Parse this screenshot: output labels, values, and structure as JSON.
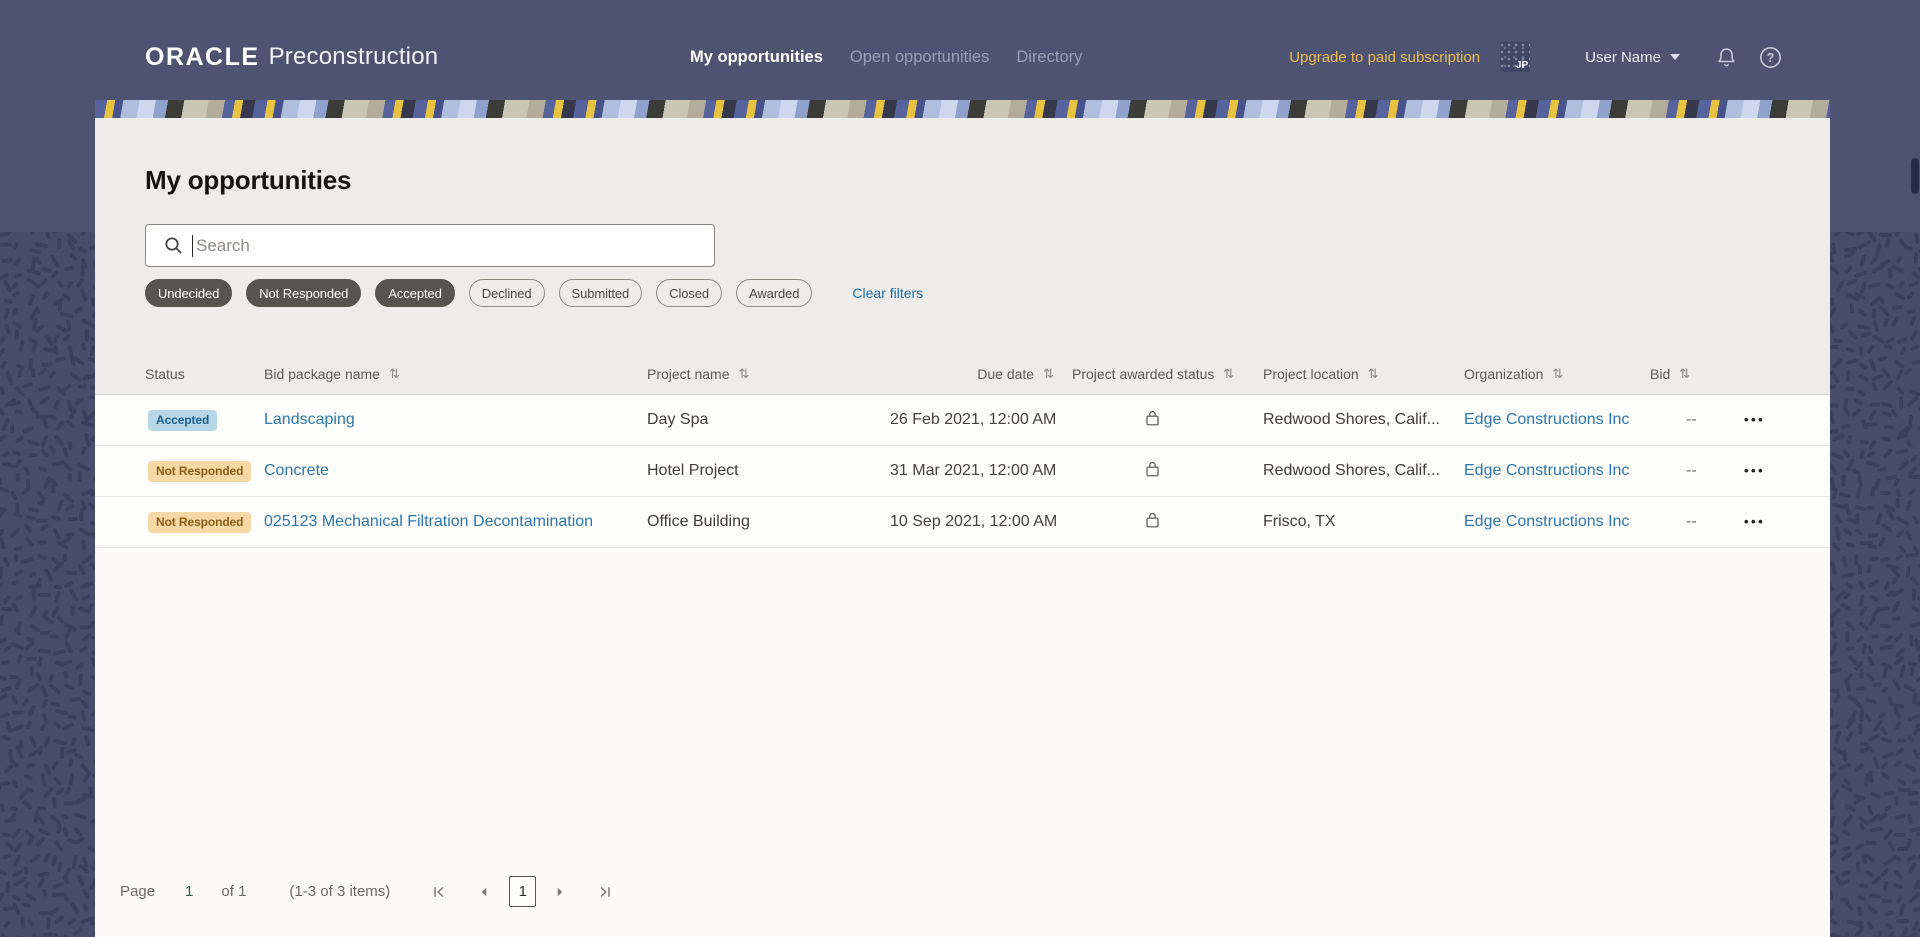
{
  "header": {
    "brand_oracle": "ORACLE",
    "brand_product": "Preconstruction",
    "nav": [
      {
        "label": "My opportunities",
        "active": true
      },
      {
        "label": "Open opportunities",
        "active": false
      },
      {
        "label": "Directory",
        "active": false
      }
    ],
    "upgrade_label": "Upgrade to paid subscription",
    "avatar_initials": "JP",
    "user_name": "User Name",
    "help_glyph": "?"
  },
  "page": {
    "title": "My opportunities",
    "search": {
      "placeholder": "Search",
      "value": ""
    },
    "filters": {
      "chips": [
        {
          "label": "Undecided",
          "selected": true
        },
        {
          "label": "Not Responded",
          "selected": true
        },
        {
          "label": "Accepted",
          "selected": true
        },
        {
          "label": "Declined",
          "selected": false
        },
        {
          "label": "Submitted",
          "selected": false
        },
        {
          "label": "Closed",
          "selected": false
        },
        {
          "label": "Awarded",
          "selected": false
        }
      ],
      "clear_label": "Clear filters"
    }
  },
  "table": {
    "sort_glyph": "⇅",
    "row_menu_glyph": "•••",
    "columns": [
      {
        "label": "Status",
        "sortable": false
      },
      {
        "label": "Bid package name",
        "sortable": true
      },
      {
        "label": "Project name",
        "sortable": true
      },
      {
        "label": "Due date",
        "sortable": true
      },
      {
        "label": "Project awarded status",
        "sortable": true
      },
      {
        "label": "Project location",
        "sortable": true
      },
      {
        "label": "Organization",
        "sortable": true
      },
      {
        "label": "Bid",
        "sortable": true
      }
    ],
    "rows": [
      {
        "status": "Accepted",
        "status_type": "accepted",
        "bid_package_name": "Landscaping",
        "project_name": "Day Spa",
        "due_date": "26 Feb 2021, 12:00 AM",
        "awarded_status_icon": "lock",
        "location": "Redwood Shores, Calif...",
        "organization": "Edge Constructions Inc",
        "bid": "--"
      },
      {
        "status": "Not Responded",
        "status_type": "not-responded",
        "bid_package_name": "Concrete",
        "project_name": "Hotel Project",
        "due_date": "31 Mar 2021, 12:00 AM",
        "awarded_status_icon": "lock",
        "location": "Redwood Shores, Calif...",
        "organization": "Edge Constructions Inc",
        "bid": "--"
      },
      {
        "status": "Not Responded",
        "status_type": "not-responded",
        "bid_package_name": "025123 Mechanical Filtration Decontamination",
        "project_name": "Office Building",
        "due_date": "10 Sep 2021, 12:00 AM",
        "awarded_status_icon": "lock",
        "location": "Frisco, TX",
        "organization": "Edge Constructions Inc",
        "bid": "--"
      }
    ]
  },
  "pagination": {
    "page_label": "Page",
    "current_page": "1",
    "of_label": "of 1",
    "items_summary": "(1-3 of 3 items)"
  },
  "colors": {
    "header_bg": "#4d5371",
    "pattern_bg": "#474d6b",
    "pattern_dash": "#3a405c",
    "link_blue": "#2b77ad",
    "upgrade_yellow": "#eebd4f",
    "chip_selected_bg": "#57534e",
    "badge_accepted_bg": "#b7d7e8",
    "badge_accepted_text": "#19608f",
    "badge_not_responded_bg": "#f6d8a4",
    "badge_not_responded_text": "#8a5d19",
    "panel_top_bg": "#edecea",
    "panel_bg": "#fbfaf9"
  }
}
